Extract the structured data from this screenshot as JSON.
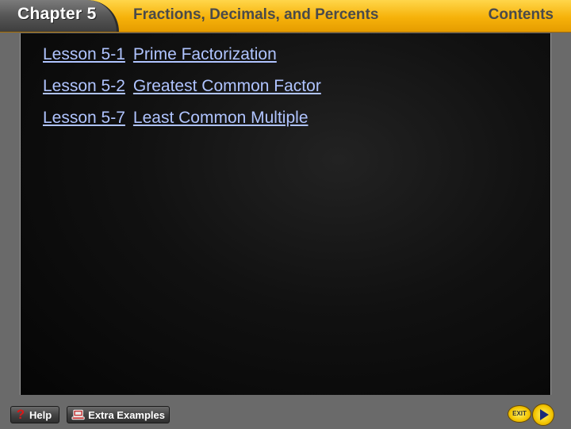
{
  "header": {
    "chapter_title": "Chapter 5",
    "unit_title": "Fractions, Decimals, and Percents",
    "contents_label": "Contents"
  },
  "lessons": [
    {
      "number": "Lesson 5-1",
      "title": "Prime Factorization"
    },
    {
      "number": "Lesson 5-2",
      "title": "Greatest Common Factor"
    },
    {
      "number": "Lesson 5-7",
      "title": "Least Common Multiple"
    }
  ],
  "footer": {
    "help_label": "Help",
    "extra_examples_label": "Extra Examples",
    "exit_label": "EXIT"
  },
  "colors": {
    "header_gold": "#f6b20a",
    "link_blue": "#b0c4ff",
    "panel_black": "#0a0a0a",
    "help_red": "#d81818"
  },
  "icons": {
    "help": "question-mark-icon",
    "extra_examples": "computer-icon",
    "exit": "exit-icon",
    "next": "play-arrow-icon"
  }
}
